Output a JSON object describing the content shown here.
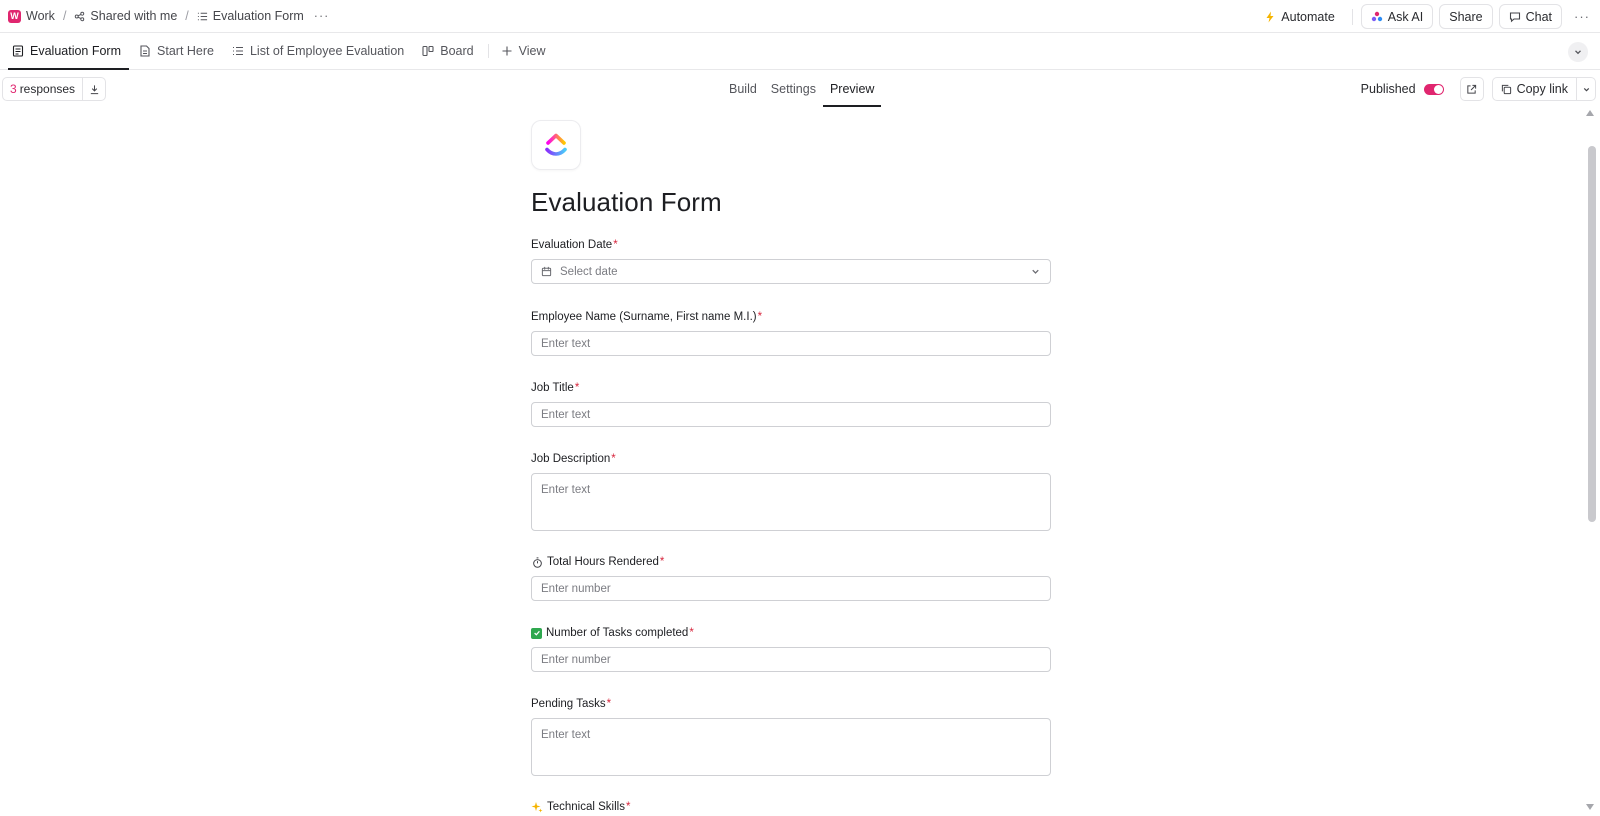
{
  "breadcrumb": {
    "workspace_badge": "W",
    "workspace": "Work",
    "shared": "Shared with me",
    "current": "Evaluation Form",
    "more": "···"
  },
  "top_actions": {
    "automate": "Automate",
    "ask_ai": "Ask AI",
    "share": "Share",
    "chat": "Chat",
    "more": "···"
  },
  "views": {
    "tabs": [
      {
        "label": "Evaluation Form",
        "icon": "form-icon",
        "active": true
      },
      {
        "label": "Start Here",
        "icon": "doc-icon",
        "active": false
      },
      {
        "label": "List of Employee Evaluation",
        "icon": "list-icon",
        "active": false
      },
      {
        "label": "Board",
        "icon": "board-icon",
        "active": false
      }
    ],
    "add_view": "View"
  },
  "form_toolbar": {
    "responses_count": "3",
    "responses_label": "responses",
    "modes": [
      "Build",
      "Settings",
      "Preview"
    ],
    "active_mode": "Preview",
    "published_label": "Published",
    "published": true,
    "copy_link": "Copy link"
  },
  "form": {
    "title": "Evaluation Form",
    "fields": [
      {
        "label": "Evaluation Date",
        "required_mark": "*",
        "placeholder": "Select date",
        "type": "date"
      },
      {
        "label": "Employee Name (Surname, First name M.I.)",
        "required_mark": "*",
        "placeholder": "Enter text",
        "type": "text"
      },
      {
        "label": "Job Title",
        "required_mark": "*",
        "placeholder": "Enter text",
        "type": "text"
      },
      {
        "label": "Job Description",
        "required_mark": "*",
        "placeholder": "Enter text",
        "type": "textarea"
      },
      {
        "label": "Total Hours Rendered",
        "required_mark": "*",
        "placeholder": "Enter number",
        "type": "number",
        "prefix_icon": "stopwatch-icon"
      },
      {
        "label": "Number of Tasks completed",
        "required_mark": "*",
        "placeholder": "Enter number",
        "type": "number",
        "prefix_icon": "checkmark-icon"
      },
      {
        "label": "Pending Tasks",
        "required_mark": "*",
        "placeholder": "Enter text",
        "type": "textarea"
      },
      {
        "label": "Technical Skills",
        "required_mark": "*",
        "type": "rating",
        "prefix_icon": "sparkles-icon"
      }
    ]
  },
  "colors": {
    "accent": "#e0266f",
    "required": "#d7263d",
    "check_green": "#2fa84f"
  }
}
